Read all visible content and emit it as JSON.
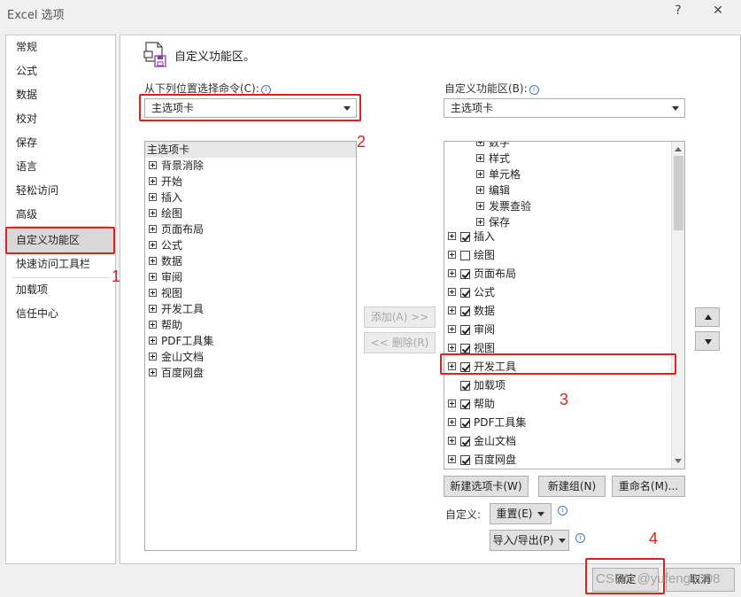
{
  "window": {
    "title": "Excel 选项",
    "help": "?",
    "close": "✕"
  },
  "nav": [
    {
      "label": "常规"
    },
    {
      "label": "公式"
    },
    {
      "label": "数据"
    },
    {
      "label": "校对"
    },
    {
      "label": "保存"
    },
    {
      "label": "语言"
    },
    {
      "label": "轻松访问"
    },
    {
      "label": "高级"
    },
    {
      "label": "自定义功能区",
      "selected": true
    },
    {
      "label": "快速访问工具栏"
    },
    {
      "label": "加载项"
    },
    {
      "label": "信任中心"
    }
  ],
  "header": {
    "title": "自定义功能区。"
  },
  "left_section": {
    "label": "从下列位置选择命令(C):",
    "combo_value": "主选项卡",
    "list_header": "主选项卡",
    "items": [
      "背景消除",
      "开始",
      "插入",
      "绘图",
      "页面布局",
      "公式",
      "数据",
      "审阅",
      "视图",
      "开发工具",
      "帮助",
      "PDF工具集",
      "金山文档",
      "百度网盘"
    ]
  },
  "middle": {
    "add": "添加(A) >>",
    "remove": "<< 删除(R)"
  },
  "right_section": {
    "label": "自定义功能区(B):",
    "combo_value": "主选项卡",
    "sub_items": [
      "数字",
      "样式",
      "单元格",
      "编辑",
      "发票查验",
      "保存"
    ],
    "items": [
      {
        "label": "插入",
        "checked": true,
        "expandable": true
      },
      {
        "label": "绘图",
        "checked": false,
        "expandable": true
      },
      {
        "label": "页面布局",
        "checked": true,
        "expandable": true
      },
      {
        "label": "公式",
        "checked": true,
        "expandable": true
      },
      {
        "label": "数据",
        "checked": true,
        "expandable": true
      },
      {
        "label": "审阅",
        "checked": true,
        "expandable": true
      },
      {
        "label": "视图",
        "checked": true,
        "expandable": true
      },
      {
        "label": "开发工具",
        "checked": true,
        "expandable": true
      },
      {
        "label": "加载项",
        "checked": true,
        "expandable": false
      },
      {
        "label": "帮助",
        "checked": true,
        "expandable": true
      },
      {
        "label": "PDF工具集",
        "checked": true,
        "expandable": true
      },
      {
        "label": "金山文档",
        "checked": true,
        "expandable": true
      },
      {
        "label": "百度网盘",
        "checked": true,
        "expandable": true
      }
    ],
    "new_tab": "新建选项卡(W)",
    "new_group": "新建组(N)",
    "rename": "重命名(M)...",
    "customize_label": "自定义:",
    "reset": "重置(E)",
    "import_export": "导入/导出(P)"
  },
  "footer": {
    "ok": "确定",
    "cancel": "取消"
  },
  "annotations": [
    "1",
    "2",
    "3",
    "4"
  ],
  "watermark": "CSDN @yufeng2008",
  "colors": {
    "annotation": "#e32020",
    "selected_nav": "#d9d9d9"
  }
}
